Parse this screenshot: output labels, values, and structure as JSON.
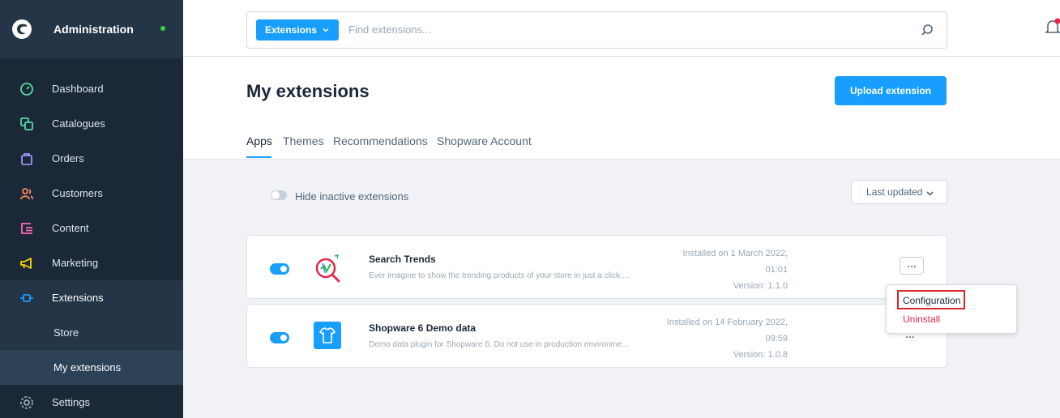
{
  "sidebar": {
    "title": "Administration",
    "status_color": "#37d046",
    "items": [
      {
        "label": "Dashboard",
        "icon": "dashboard-icon",
        "color": "#57d9a3"
      },
      {
        "label": "Catalogues",
        "icon": "catalogues-icon",
        "color": "#57d9a3"
      },
      {
        "label": "Orders",
        "icon": "orders-icon",
        "color": "#a092f0"
      },
      {
        "label": "Customers",
        "icon": "customers-icon",
        "color": "#f88962"
      },
      {
        "label": "Content",
        "icon": "content-icon",
        "color": "#ff68b4"
      },
      {
        "label": "Marketing",
        "icon": "marketing-icon",
        "color": "#ffd700"
      },
      {
        "label": "Extensions",
        "icon": "extensions-icon",
        "color": "#189eff"
      },
      {
        "label": "Settings",
        "icon": "settings-icon",
        "color": "#9aa8b5"
      }
    ],
    "sub_items": [
      {
        "label": "Store"
      },
      {
        "label": "My extensions"
      }
    ]
  },
  "search": {
    "type_label": "Extensions",
    "placeholder": "Find extensions..."
  },
  "page": {
    "title": "My extensions",
    "upload_label": "Upload extension"
  },
  "tabs": [
    {
      "label": "Apps",
      "active": true
    },
    {
      "label": "Themes"
    },
    {
      "label": "Recommendations"
    },
    {
      "label": "Shopware Account"
    }
  ],
  "filters": {
    "hide_inactive_label": "Hide inactive extensions",
    "sort_label": "Last updated"
  },
  "extensions": [
    {
      "name": "Search Trends",
      "description": "Ever imagine to show the trending products of your store in just a click ...",
      "installed_line1": "Installed on 1 March 2022,",
      "installed_line2": "01:01",
      "version": "Version: 1.1.0",
      "active": true,
      "icon": "search-trends-logo-icon"
    },
    {
      "name": "Shopware 6 Demo data",
      "description": "Demo data plugin for Shopware 6. Do not use in production environme...",
      "installed_line1": "Installed on 14 February 2022,",
      "installed_line2": "09:59",
      "version": "Version: 1.0.8",
      "active": true,
      "icon": "tshirt-icon"
    }
  ],
  "more_label": "…",
  "context_menu": {
    "configuration": "Configuration",
    "uninstall": "Uninstall"
  },
  "colors": {
    "accent": "#189eff",
    "sidebar_bg": "#1b2838",
    "danger": "#de294c",
    "highlight": "#d9262a"
  }
}
